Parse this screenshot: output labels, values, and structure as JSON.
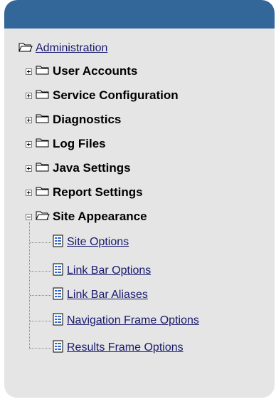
{
  "tree": {
    "root": {
      "label": "Administration",
      "icon": "folder-open-icon"
    },
    "items": [
      {
        "label": "User Accounts",
        "expanded": false,
        "icon": "folder-closed-icon"
      },
      {
        "label": "Service Configuration",
        "expanded": false,
        "icon": "folder-closed-icon"
      },
      {
        "label": "Diagnostics",
        "expanded": false,
        "icon": "folder-closed-icon"
      },
      {
        "label": "Log Files",
        "expanded": false,
        "icon": "folder-closed-icon"
      },
      {
        "label": "Java Settings",
        "expanded": false,
        "icon": "folder-closed-icon"
      },
      {
        "label": "Report Settings",
        "expanded": false,
        "icon": "folder-closed-icon"
      },
      {
        "label": "Site Appearance",
        "expanded": true,
        "icon": "folder-open-icon"
      }
    ],
    "children": [
      {
        "label": "Site Options",
        "icon": "page-icon"
      },
      {
        "label": "Link Bar Options",
        "icon": "page-icon"
      },
      {
        "label": "Link Bar Aliases",
        "icon": "page-icon"
      },
      {
        "label": "Navigation Frame Options",
        "icon": "page-icon"
      },
      {
        "label": "Results Frame Options",
        "icon": "page-icon"
      }
    ]
  },
  "colors": {
    "header": "#336699",
    "panel": "#e5e5e5",
    "link": "#1a1a6e"
  }
}
